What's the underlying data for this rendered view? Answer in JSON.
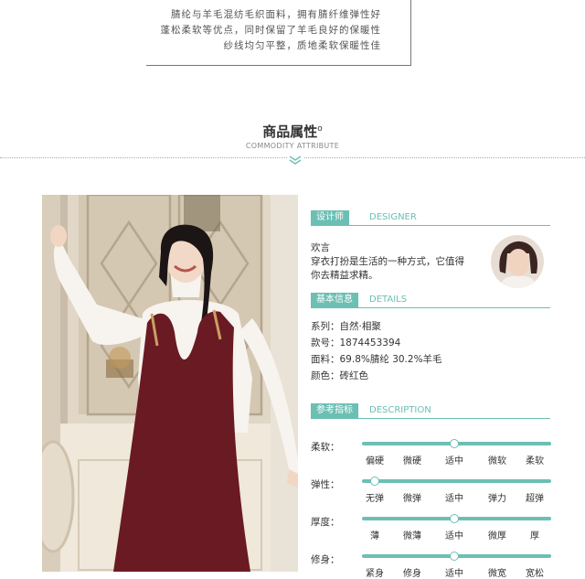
{
  "intro": {
    "lines": [
      "腈纶与羊毛混纺毛织面料，拥有腈纤维弹性好",
      "蓬松柔软等优点，同时保留了羊毛良好的保暖性",
      "纱线均匀平整，质地柔软保暖性佳"
    ]
  },
  "section": {
    "title": "商品属性",
    "title_mark": "o",
    "subtitle": "COMMODITY ATTRIBUTE"
  },
  "designer": {
    "tag": "设计师",
    "tag_en": "DESIGNER",
    "name": "欢言",
    "quote_line1": "穿衣打扮是生活的一种方式，它值得",
    "quote_line2": "你去精益求精。"
  },
  "basic": {
    "tag": "基本信息",
    "tag_en": "DETAILS",
    "series": "系列：自然·相聚",
    "model": "款号：1874453394",
    "fabric": "面料：69.8%腈纶 30.2%羊毛",
    "color": "颜色：砖红色"
  },
  "reference": {
    "tag": "参考指标",
    "tag_en": "DESCRIPTION",
    "attributes": [
      {
        "label": "柔软：",
        "options": [
          "偏硬",
          "微硬",
          "适中",
          "微软",
          "柔软"
        ],
        "selected": 2
      },
      {
        "label": "弹性：",
        "options": [
          "无弹",
          "微弹",
          "适中",
          "弹力",
          "超弹"
        ],
        "selected": 0
      },
      {
        "label": "厚度：",
        "options": [
          "薄",
          "微薄",
          "适中",
          "微厚",
          "厚"
        ],
        "selected": 2
      },
      {
        "label": "修身：",
        "options": [
          "紧身",
          "修身",
          "适中",
          "微宽",
          "宽松"
        ],
        "selected": 2
      }
    ]
  },
  "colors": {
    "accent": "#6bbfb3",
    "dress": "#6a1a22"
  }
}
